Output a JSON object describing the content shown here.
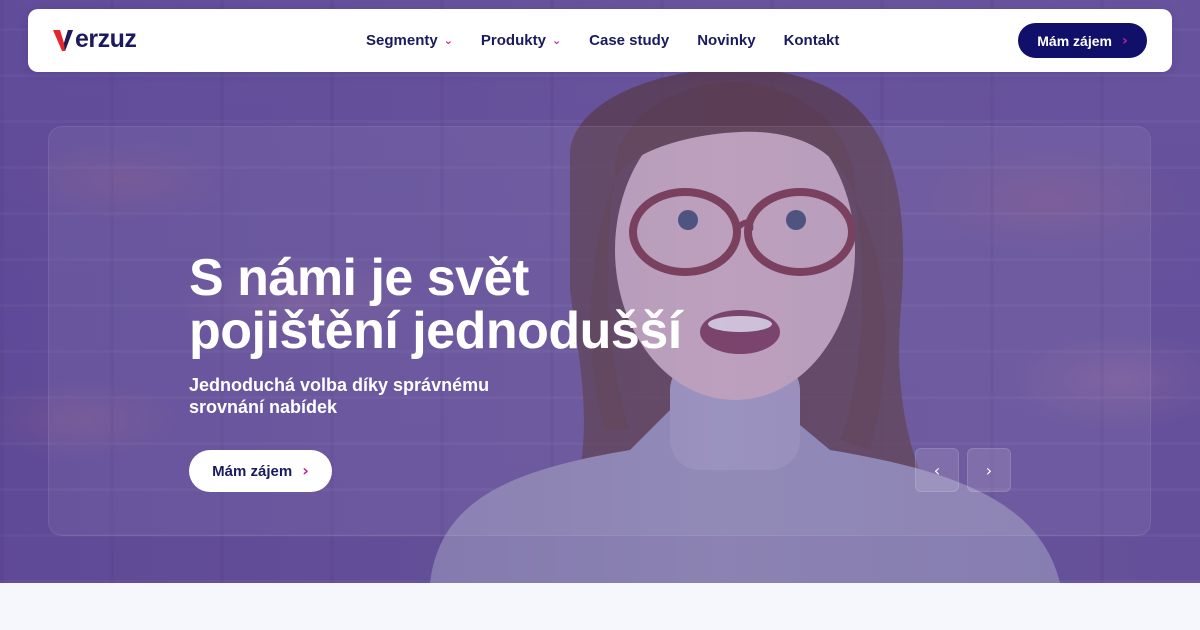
{
  "brand": {
    "name": "Verzuz",
    "rest": "erzuz"
  },
  "nav": {
    "items": [
      {
        "label": "Segmenty",
        "has_dropdown": true
      },
      {
        "label": "Produkty",
        "has_dropdown": true
      },
      {
        "label": "Case study",
        "has_dropdown": false
      },
      {
        "label": "Novinky",
        "has_dropdown": false
      },
      {
        "label": "Kontakt",
        "has_dropdown": false
      }
    ],
    "cta_label": "Mám zájem"
  },
  "hero": {
    "title_line1": "S námi je svět",
    "title_line2": "pojištění jednodušší",
    "subtitle_line1": "Jednoduchá volba díky správnému",
    "subtitle_line2": "srovnání nabídek",
    "cta_label": "Mám zájem"
  },
  "icons": {
    "nav_caret": "chevron-down-icon",
    "cta_arrow": "chevron-right-icon",
    "slider_prev": "chevron-left-icon",
    "slider_next": "chevron-right-icon"
  },
  "colors": {
    "primary_navy": "#10106a",
    "text_navy": "#1c1a5e",
    "accent_magenta": "#c6219a",
    "hero_overlay": "#6a5699",
    "logo_red": "#e4262c"
  }
}
